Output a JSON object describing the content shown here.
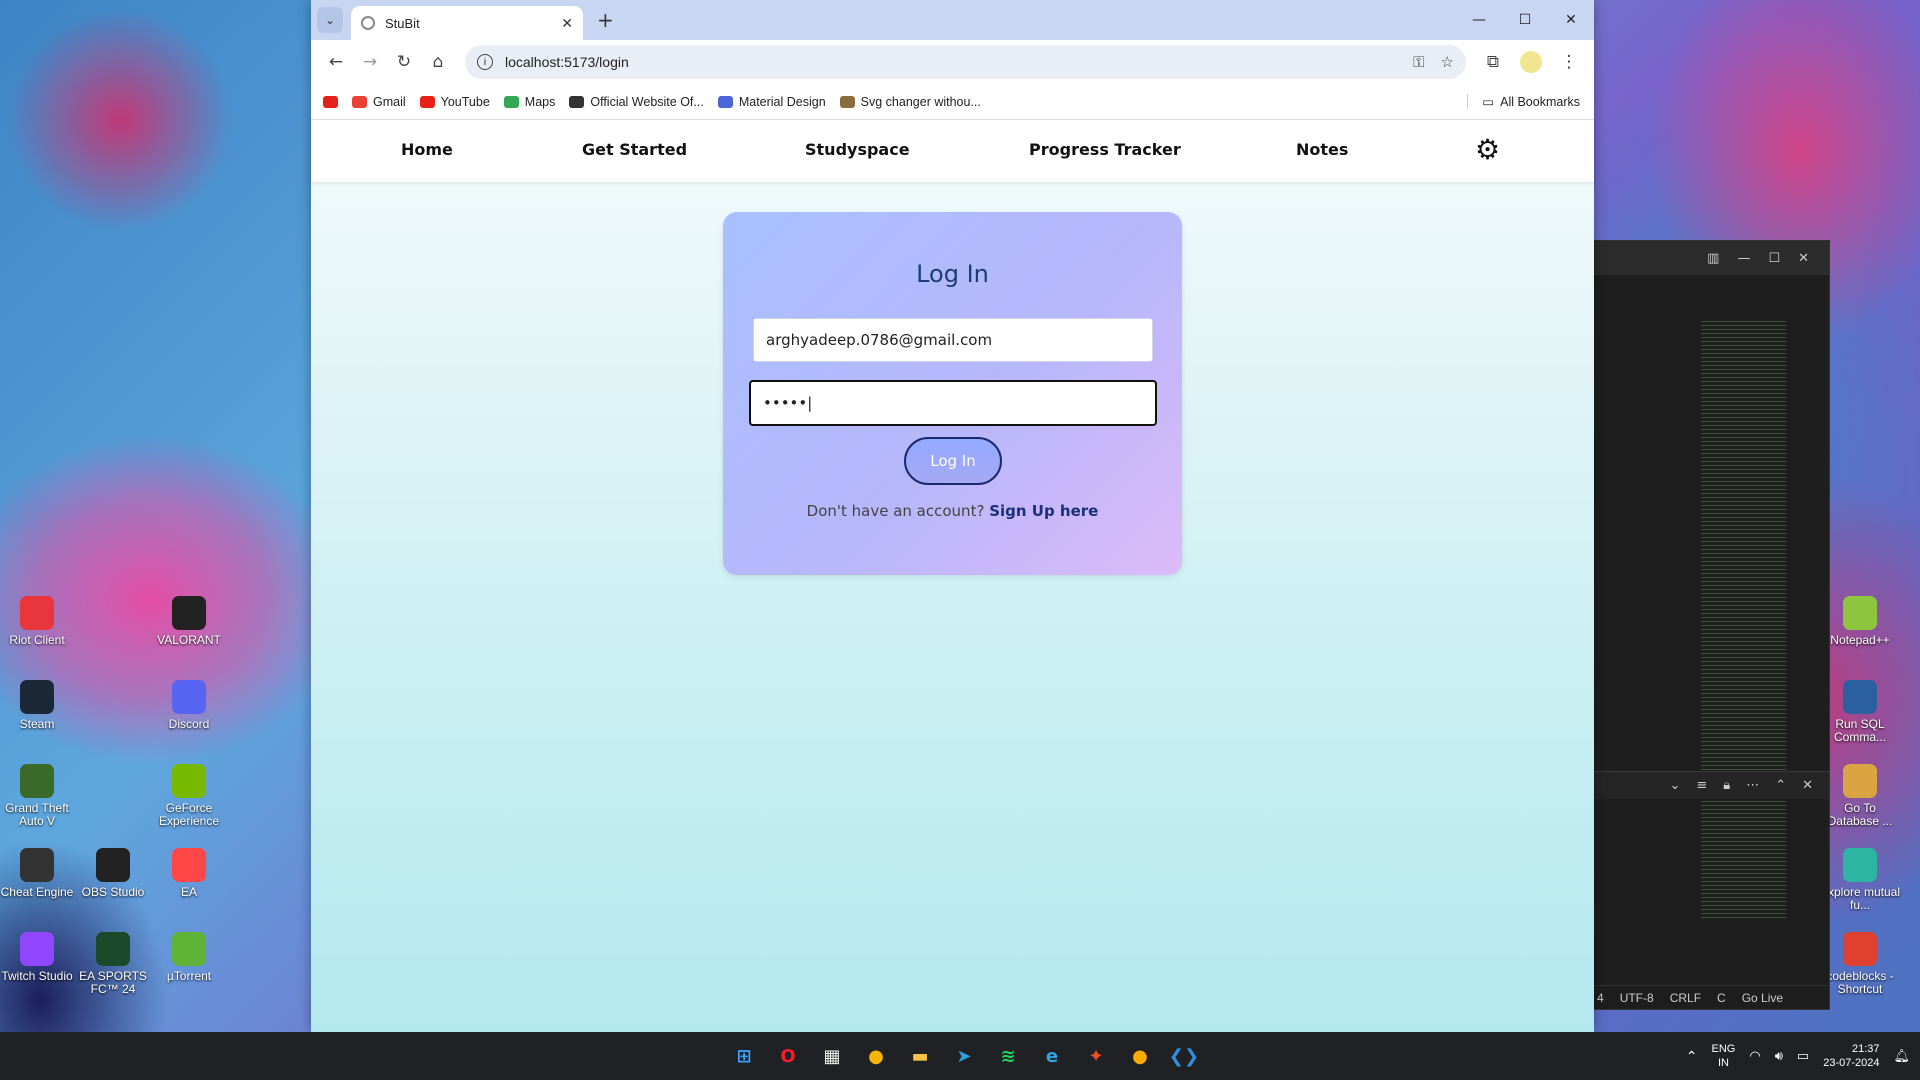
{
  "browser": {
    "tab_title": "StuBit",
    "tab_menu_icon": "chevron-down-icon",
    "url": "localhost:5173/login",
    "window_controls": [
      "—",
      "☐",
      "✕"
    ],
    "bookmarks": [
      {
        "label": "",
        "color": "#e62117"
      },
      {
        "label": "Gmail",
        "color": "#ea4335"
      },
      {
        "label": "YouTube",
        "color": "#e62117"
      },
      {
        "label": "Maps",
        "color": "#34a853"
      },
      {
        "label": "Official Website Of...",
        "color": "#333333"
      },
      {
        "label": "Material Design",
        "color": "#4a66d8"
      },
      {
        "label": "Svg changer withou...",
        "color": "#8a6d3b"
      }
    ],
    "all_bookmarks": "All Bookmarks"
  },
  "nav": {
    "items": [
      "Home",
      "Get Started",
      "Studyspace",
      "Progress Tracker",
      "Notes"
    ],
    "settings_icon": "gear-icon"
  },
  "login": {
    "title": "Log In",
    "email_value": "arghyadeep.0786@gmail.com",
    "password_masked": "•••••|",
    "button_label": "Log In",
    "signup_prompt": "Don't have an account?",
    "signup_link": "Sign Up here"
  },
  "desktop_icons_left": [
    {
      "label": "Riot Client",
      "color": "#e8363c"
    },
    {
      "label": "VALORANT",
      "color": "#222222"
    },
    {
      "label": "Steam",
      "color": "#1b2838"
    },
    {
      "label": "Discord",
      "color": "#5865f2"
    },
    {
      "label": "Grand Theft Auto V",
      "color": "#3a6a2a"
    },
    {
      "label": "GeForce Experience",
      "color": "#76b900"
    },
    {
      "label": "Cheat Engine",
      "color": "#333333"
    },
    {
      "label": "OBS Studio",
      "color": "#222222"
    },
    {
      "label": "EA",
      "color": "#ff4747"
    },
    {
      "label": "Twitch Studio",
      "color": "#9146ff"
    },
    {
      "label": "EA SPORTS FC™ 24",
      "color": "#1a4a2a"
    },
    {
      "label": "µTorrent",
      "color": "#5fb336"
    }
  ],
  "desktop_icons_right": [
    {
      "label": "Notepad++",
      "color": "#8fc43e"
    },
    {
      "label": "Run SQL Comma...",
      "color": "#2a5fa0"
    },
    {
      "label": "Go To Database ...",
      "color": "#d9a441"
    },
    {
      "label": "Explore mutual fu...",
      "color": "#2db5a3"
    },
    {
      "label": "codeblocks - Shortcut",
      "color": "#e0402f"
    }
  ],
  "editor": {
    "status_items": [
      "4",
      "UTF-8",
      "CRLF",
      "C",
      "Go Live"
    ]
  },
  "taskbar": {
    "apps": [
      {
        "name": "windows-start-icon",
        "glyph": "⊞",
        "color": "#3aa0ff"
      },
      {
        "name": "opera-icon",
        "glyph": "O",
        "color": "#ff1b2d"
      },
      {
        "name": "store-icon",
        "glyph": "▦",
        "color": "#f2f2f2"
      },
      {
        "name": "chrome-icon",
        "glyph": "●",
        "color": "#f4b400"
      },
      {
        "name": "file-explorer-icon",
        "glyph": "▬",
        "color": "#f6c343"
      },
      {
        "name": "telegram-icon",
        "glyph": "➤",
        "color": "#2aa3df"
      },
      {
        "name": "spotify-icon",
        "glyph": "≋",
        "color": "#1ed760"
      },
      {
        "name": "edge-icon",
        "glyph": "e",
        "color": "#2fa6e8"
      },
      {
        "name": "figma-icon",
        "glyph": "✦",
        "color": "#f24e1e"
      },
      {
        "name": "chrome-canary-icon",
        "glyph": "●",
        "color": "#f9ab00"
      },
      {
        "name": "vscode-icon",
        "glyph": "❮❯",
        "color": "#2f8fe0"
      }
    ],
    "lang_top": "ENG",
    "lang_bottom": "IN",
    "time": "21:37",
    "date": "23-07-2024"
  }
}
